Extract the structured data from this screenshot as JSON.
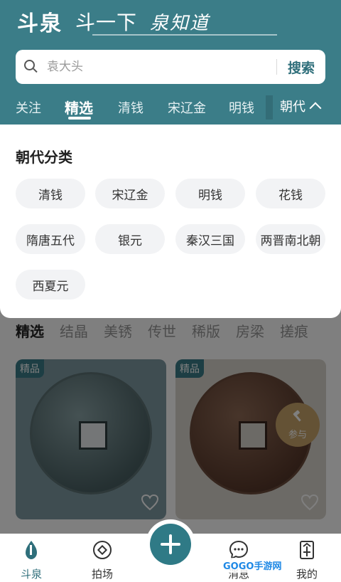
{
  "header": {
    "banner": {
      "part1": "斗泉",
      "part2": "斗一下",
      "part3": "泉知道"
    },
    "search": {
      "placeholder": "袁大头",
      "button": "搜索"
    },
    "tabs": [
      {
        "label": "关注"
      },
      {
        "label": "精选"
      },
      {
        "label": "清钱"
      },
      {
        "label": "宋辽金"
      },
      {
        "label": "明钱"
      }
    ],
    "era_toggle": "朝代"
  },
  "panel": {
    "title": "朝代分类",
    "chips": [
      "清钱",
      "宋辽金",
      "明钱",
      "花钱",
      "隋唐五代",
      "银元",
      "秦汉三国",
      "两晋南北朝",
      "西夏元"
    ]
  },
  "background": {
    "subtabs": [
      "精选",
      "结晶",
      "美锈",
      "传世",
      "稀版",
      "房梁",
      "搓痕"
    ],
    "card_badge": "精品",
    "bid_label": "参与"
  },
  "bottom_nav": {
    "items": [
      {
        "label": "斗泉",
        "icon": "drop-icon"
      },
      {
        "label": "拍场",
        "icon": "coin-circle-icon"
      },
      {
        "label": "消息",
        "icon": "chat-icon"
      },
      {
        "label": "我的",
        "icon": "profile-icon"
      }
    ]
  },
  "watermark": "GOGO手游网",
  "colors": {
    "header": "#3b7d88",
    "accent": "#2f6f7b",
    "chip_bg": "#f2f3f5"
  }
}
